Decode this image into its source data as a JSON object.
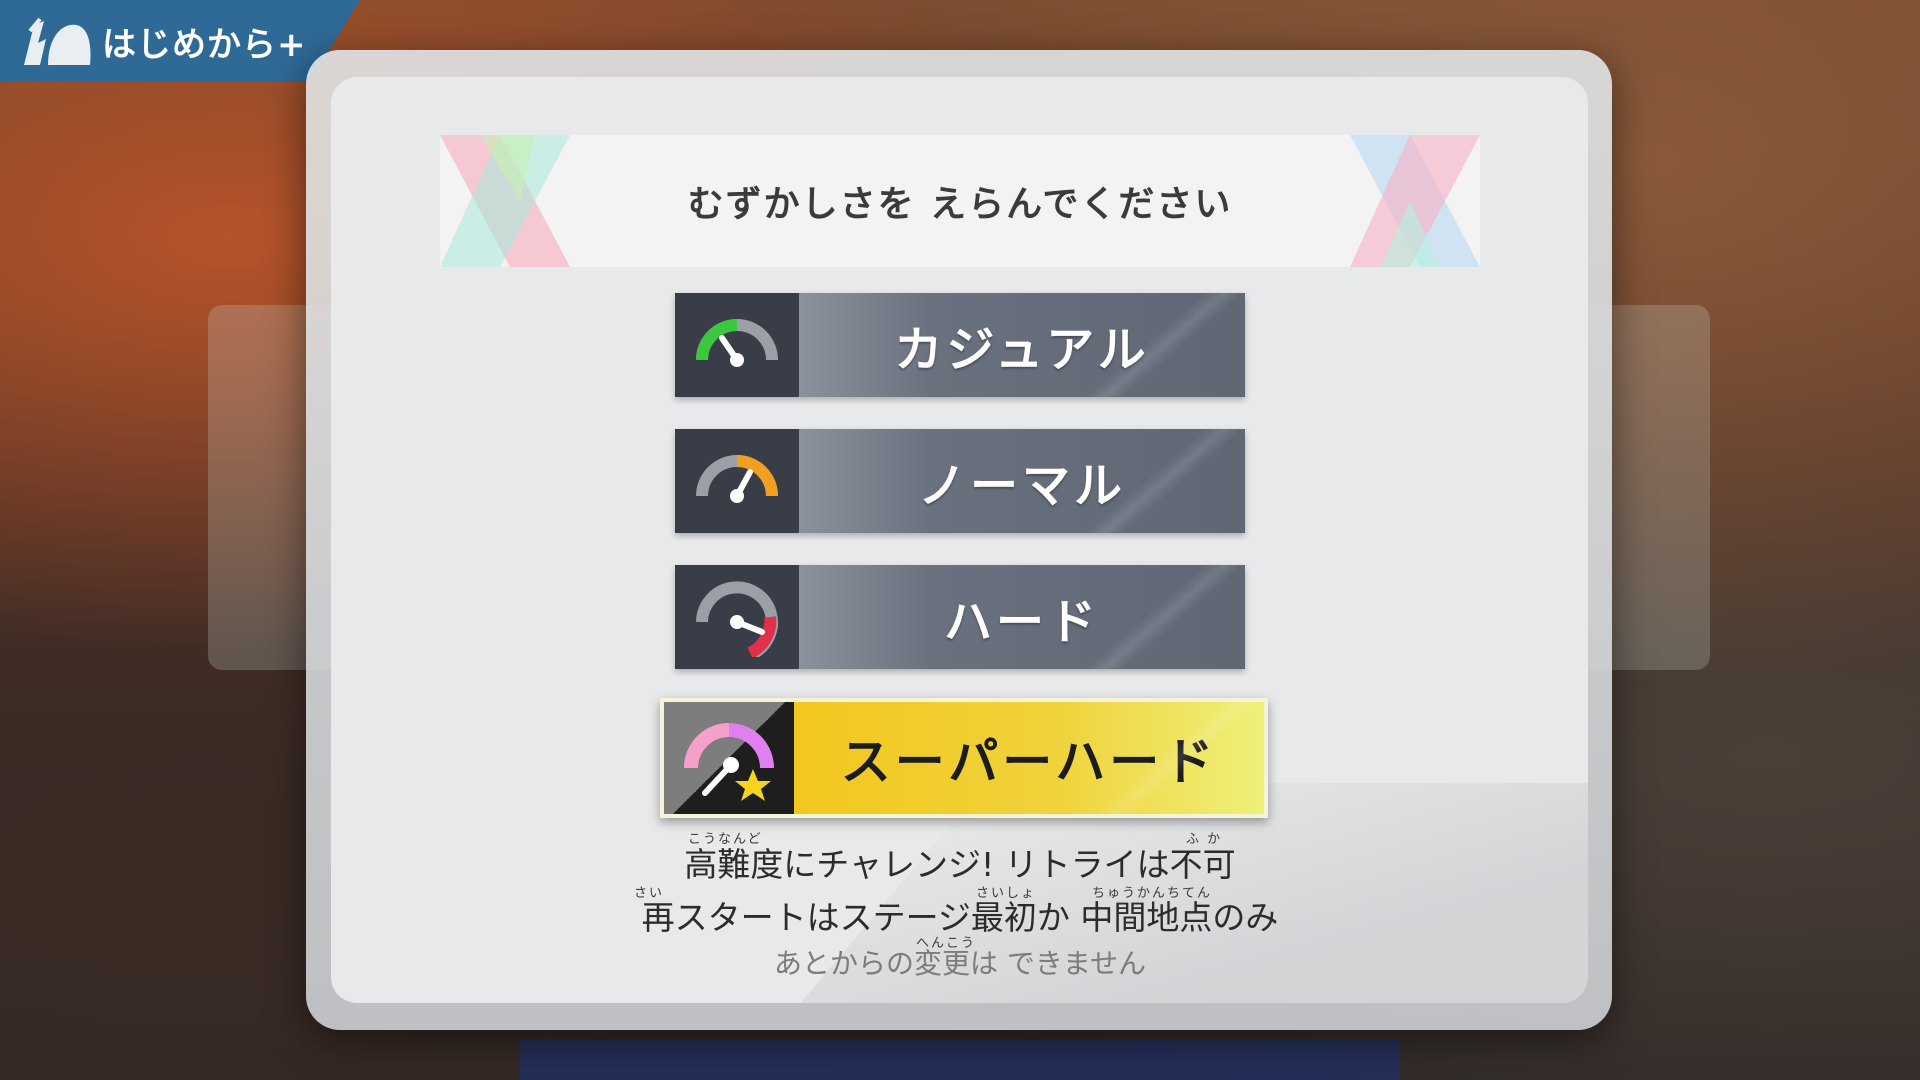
{
  "corner_tag": {
    "label": "はじめから+"
  },
  "dialog": {
    "title": "むずかしさを えらんでください",
    "options": [
      {
        "label": "カジュアル"
      },
      {
        "label": "ノーマル"
      },
      {
        "label": "ハード"
      },
      {
        "label": "スーパーハード"
      }
    ],
    "selected_index": 3,
    "description": {
      "line1": "高難度にチャレンジ! リトライは不可",
      "line2": "再スタートはステージ最初か 中間地点のみ",
      "note": "あとからの変更は できません",
      "ruby": {
        "kounando": "こうなんど",
        "fuka": "ふ か",
        "sai": "さい",
        "saisho": "さいしょ",
        "chuukanchiten": "ちゅうかんちてん",
        "henkou": "へんこう"
      }
    }
  },
  "colors": {
    "gauge_casual": "#3cc83c",
    "gauge_normal": "#f0a020",
    "gauge_hard": "#e0304a",
    "gauge_superhard": "#e080f0",
    "selected_bg": "#f2c71e"
  },
  "icons": [
    "runner-icon",
    "gauge-casual-icon",
    "gauge-normal-icon",
    "gauge-hard-icon",
    "gauge-superhard-icon"
  ]
}
